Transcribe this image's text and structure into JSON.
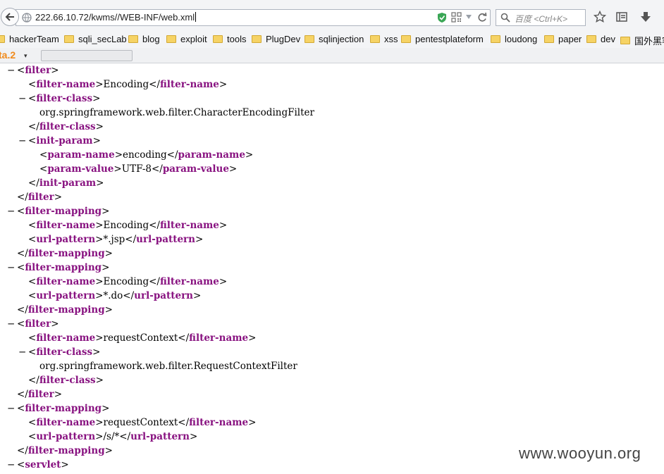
{
  "browser": {
    "url": "222.66.10.72/kwms//WEB-INF/web.xml",
    "search_placeholder": "百度 <Ctrl+K>",
    "bookmarks": [
      {
        "label": "hackerTeam"
      },
      {
        "label": "sqli_secLab"
      },
      {
        "label": "blog"
      },
      {
        "label": "exploit"
      },
      {
        "label": "tools"
      },
      {
        "label": "PlugDev"
      },
      {
        "label": "sqlinjection"
      },
      {
        "label": "xss"
      },
      {
        "label": "pentestplateform"
      },
      {
        "label": "loudong"
      },
      {
        "label": "paper"
      },
      {
        "label": "dev"
      },
      {
        "label": "国外黑客"
      }
    ],
    "hackbar_label": "ta.2",
    "hackbar_dropdown": "▾"
  },
  "xml": {
    "lines": [
      {
        "toggle": "−",
        "open": "filter",
        "text": "",
        "close": ""
      },
      {
        "toggle": "",
        "open": "filter-name",
        "text": "Encoding",
        "close": "filter-name"
      },
      {
        "toggle": "−",
        "open": "filter-class",
        "text": "",
        "close": ""
      },
      {
        "toggle": "",
        "open": "",
        "text": "org.springframework.web.filter.CharacterEncodingFilter",
        "close": ""
      },
      {
        "toggle": "",
        "open": "",
        "text": "",
        "close": "filter-class"
      },
      {
        "toggle": "−",
        "open": "init-param",
        "text": "",
        "close": ""
      },
      {
        "toggle": "",
        "open": "param-name",
        "text": "encoding",
        "close": "param-name"
      },
      {
        "toggle": "",
        "open": "param-value",
        "text": "UTF-8",
        "close": "param-value"
      },
      {
        "toggle": "",
        "open": "",
        "text": "",
        "close": "init-param"
      },
      {
        "toggle": "",
        "open": "",
        "text": "",
        "close": "filter"
      },
      {
        "toggle": "−",
        "open": "filter-mapping",
        "text": "",
        "close": ""
      },
      {
        "toggle": "",
        "open": "filter-name",
        "text": "Encoding",
        "close": "filter-name"
      },
      {
        "toggle": "",
        "open": "url-pattern",
        "text": "*.jsp",
        "close": "url-pattern"
      },
      {
        "toggle": "",
        "open": "",
        "text": "",
        "close": "filter-mapping"
      },
      {
        "toggle": "−",
        "open": "filter-mapping",
        "text": "",
        "close": ""
      },
      {
        "toggle": "",
        "open": "filter-name",
        "text": "Encoding",
        "close": "filter-name"
      },
      {
        "toggle": "",
        "open": "url-pattern",
        "text": "*.do",
        "close": "url-pattern"
      },
      {
        "toggle": "",
        "open": "",
        "text": "",
        "close": "filter-mapping"
      },
      {
        "toggle": "−",
        "open": "filter",
        "text": "",
        "close": ""
      },
      {
        "toggle": "",
        "open": "filter-name",
        "text": "requestContext",
        "close": "filter-name"
      },
      {
        "toggle": "−",
        "open": "filter-class",
        "text": "",
        "close": ""
      },
      {
        "toggle": "",
        "open": "",
        "text": "org.springframework.web.filter.RequestContextFilter",
        "close": ""
      },
      {
        "toggle": "",
        "open": "",
        "text": "",
        "close": "filter-class"
      },
      {
        "toggle": "",
        "open": "",
        "text": "",
        "close": "filter"
      },
      {
        "toggle": "−",
        "open": "filter-mapping",
        "text": "",
        "close": ""
      },
      {
        "toggle": "",
        "open": "filter-name",
        "text": "requestContext",
        "close": "filter-name"
      },
      {
        "toggle": "",
        "open": "url-pattern",
        "text": "/s/*",
        "close": "url-pattern"
      },
      {
        "toggle": "",
        "open": "",
        "text": "",
        "close": "filter-mapping"
      },
      {
        "toggle": "−",
        "open": "servlet",
        "text": "",
        "close": ""
      }
    ]
  },
  "watermark": "www.wooyun.org",
  "colors": {
    "tag": "#881280",
    "chrome": "#f3f4f6",
    "hackbar_logo": "#f08a1c"
  }
}
